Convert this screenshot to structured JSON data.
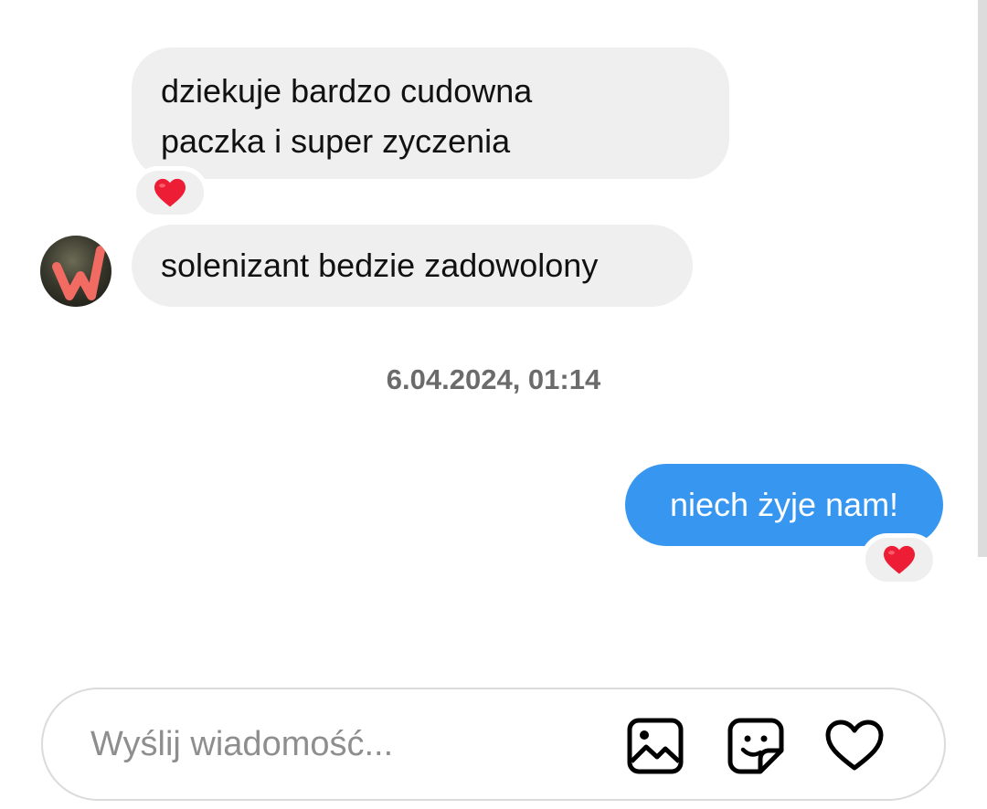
{
  "messages": [
    {
      "sender": "other",
      "text_lines": [
        "dziekuje bardzo cudowna",
        "paczka i super zyczenia"
      ],
      "reaction": "heart"
    },
    {
      "sender": "other",
      "text": "solenizant bedzie zadowolony"
    },
    {
      "sender": "me",
      "text": "niech żyje nam!",
      "reaction": "heart"
    }
  ],
  "timestamp": "6.04.2024, 01:14",
  "composer": {
    "placeholder": "Wyślij wiadomość...",
    "value": "",
    "icons": [
      "image-icon",
      "sticker-icon",
      "heart-icon"
    ]
  },
  "colors": {
    "incoming_bubble": "#efefef",
    "outgoing_bubble": "#3797f0",
    "reaction_heart": "#ee1d36",
    "timestamp_text": "#6b6b6b"
  }
}
